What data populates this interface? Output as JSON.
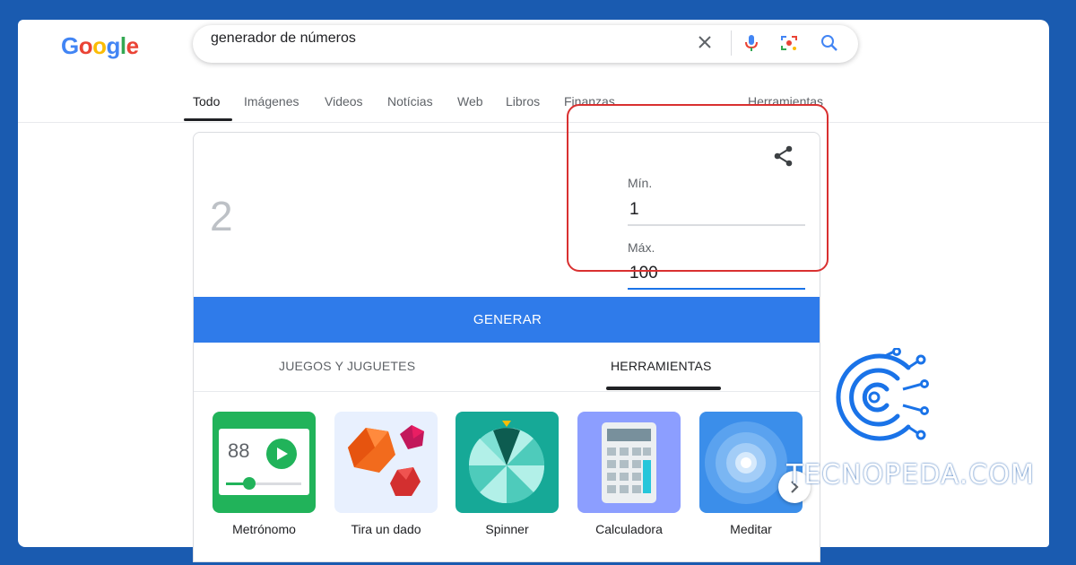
{
  "search": {
    "logo_letters": [
      "G",
      "o",
      "o",
      "g",
      "l",
      "e"
    ],
    "query": "generador de números",
    "clear_icon": "close-icon",
    "voice_icon": "mic-icon",
    "lens_icon": "camera-lens-icon",
    "search_icon": "search-icon"
  },
  "nav_tabs": {
    "todo": "Todo",
    "imagenes": "Imágenes",
    "videos": "Videos",
    "noticias": "Notícias",
    "web": "Web",
    "libros": "Libros",
    "finanzas": "Finanzas",
    "herramientas": "Herramientas"
  },
  "generator": {
    "result": "2",
    "min_label": "Mín.",
    "min_value": "1",
    "max_label": "Máx.",
    "max_value": "100",
    "button_label": "GENERAR",
    "share_icon": "share-icon"
  },
  "categories": {
    "games": "JUEGOS Y JUGUETES",
    "tools": "HERRAMIENTAS"
  },
  "tools": {
    "metronome": {
      "label": "Metrónomo",
      "bpm": "88"
    },
    "dice": {
      "label": "Tira un dado"
    },
    "spinner": {
      "label": "Spinner"
    },
    "calculator": {
      "label": "Calculadora"
    },
    "meditate": {
      "label": "Meditar"
    }
  },
  "brand": {
    "text": "TECNOPEDA.COM"
  },
  "colors": {
    "frame": "#1a5bb0",
    "generate_button": "#2f7bea",
    "highlight": "#d93030"
  }
}
